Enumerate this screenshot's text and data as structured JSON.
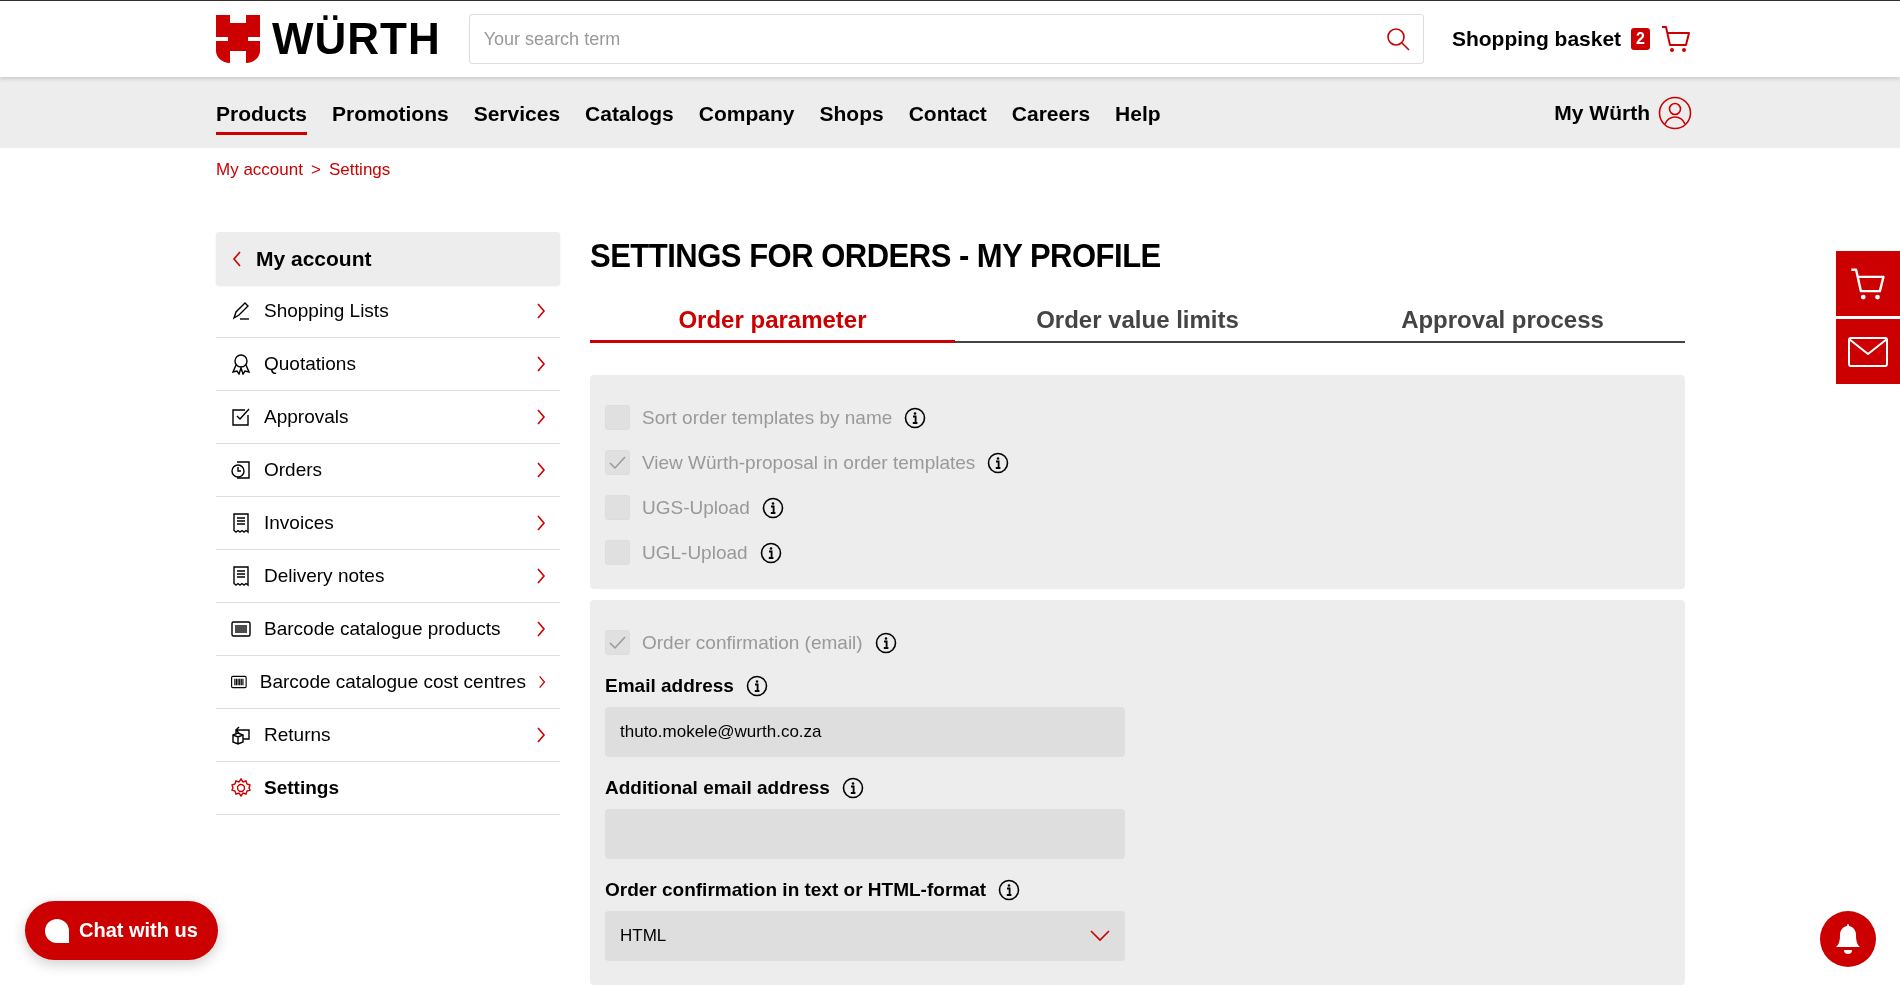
{
  "header": {
    "logo_text": "WÜRTH",
    "search": {
      "placeholder": "Your search term"
    },
    "basket": {
      "label": "Shopping basket",
      "count": "2"
    }
  },
  "nav": {
    "items": [
      {
        "label": "Products",
        "selected": true
      },
      {
        "label": "Promotions",
        "selected": false
      },
      {
        "label": "Services",
        "selected": false
      },
      {
        "label": "Catalogs",
        "selected": false
      },
      {
        "label": "Company",
        "selected": false
      },
      {
        "label": "Shops",
        "selected": false
      },
      {
        "label": "Contact",
        "selected": false
      },
      {
        "label": "Careers",
        "selected": false
      },
      {
        "label": "Help",
        "selected": false
      }
    ],
    "account": "My Würth"
  },
  "breadcrumb": [
    "My account",
    "Settings"
  ],
  "breadcrumb_separator": ">",
  "sidebar": {
    "title": "My account",
    "items": [
      {
        "label": "Shopping Lists",
        "kind": "pencil",
        "selected": false
      },
      {
        "label": "Quotations",
        "kind": "ribbon",
        "selected": false
      },
      {
        "label": "Approvals",
        "kind": "check",
        "selected": false
      },
      {
        "label": "Orders",
        "kind": "clock",
        "selected": false
      },
      {
        "label": "Invoices",
        "kind": "receipt",
        "selected": false
      },
      {
        "label": "Delivery notes",
        "kind": "receipt",
        "selected": false
      },
      {
        "label": "Barcode catalogue products",
        "kind": "barcode",
        "selected": false
      },
      {
        "label": "Barcode catalogue cost centres",
        "kind": "barcode",
        "selected": false
      },
      {
        "label": "Returns",
        "kind": "box",
        "selected": false
      },
      {
        "label": "Settings",
        "kind": "gear",
        "selected": true
      }
    ]
  },
  "page_title": "SETTINGS FOR ORDERS - MY PROFILE",
  "tabs": [
    {
      "label": "Order parameter",
      "selected": true
    },
    {
      "label": "Order value limits",
      "selected": false
    },
    {
      "label": "Approval process",
      "selected": false
    }
  ],
  "parameters": [
    {
      "label": "Sort order templates by name",
      "checked": false,
      "disabled": true
    },
    {
      "label": "View Würth-proposal in order templates",
      "checked": true,
      "disabled": true
    },
    {
      "label": "UGS-Upload",
      "checked": false,
      "disabled": true
    },
    {
      "label": "UGL-Upload",
      "checked": false,
      "disabled": true
    }
  ],
  "confirmation": {
    "checkbox": {
      "label": "Order confirmation (email)",
      "checked": true,
      "disabled": true
    },
    "fields": [
      {
        "label": "Email address",
        "kind": "input",
        "value": "thuto.mokele@wurth.co.za"
      },
      {
        "label": "Additional email address",
        "kind": "input"
      },
      {
        "label": "Order confirmation in text or HTML-format",
        "kind": "select",
        "value": "HTML"
      }
    ]
  },
  "chat_button": "Chat with us"
}
